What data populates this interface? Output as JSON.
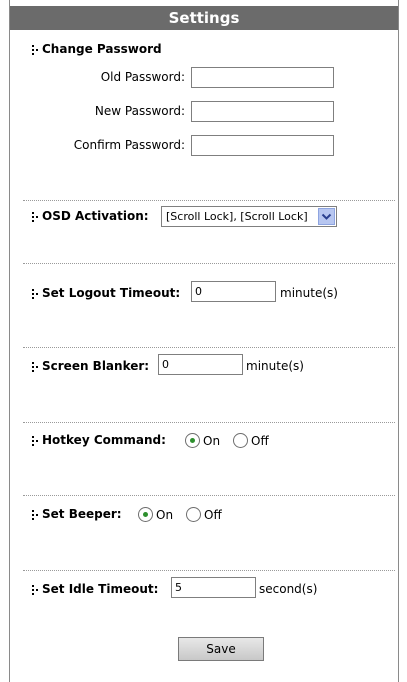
{
  "header": {
    "title": "Settings"
  },
  "password": {
    "section_label": "Change Password",
    "old_label": "Old Password:",
    "new_label": "New Password:",
    "confirm_label": "Confirm Password:",
    "old_value": "",
    "new_value": "",
    "confirm_value": ""
  },
  "osd": {
    "label": "OSD Activation:",
    "selected": "[Scroll Lock], [Scroll Lock]"
  },
  "logout": {
    "label": "Set Logout Timeout:",
    "value": "0",
    "unit": "minute(s)"
  },
  "blanker": {
    "label": "Screen Blanker:",
    "value": "0",
    "unit": "minute(s)"
  },
  "hotkey": {
    "label": "Hotkey Command:",
    "on_label": "On",
    "off_label": "Off",
    "selected": "On"
  },
  "beeper": {
    "label": "Set Beeper:",
    "on_label": "On",
    "off_label": "Off",
    "selected": "On"
  },
  "idle": {
    "label": "Set Idle Timeout:",
    "value": "5",
    "unit": "second(s)"
  },
  "actions": {
    "save_label": "Save"
  }
}
